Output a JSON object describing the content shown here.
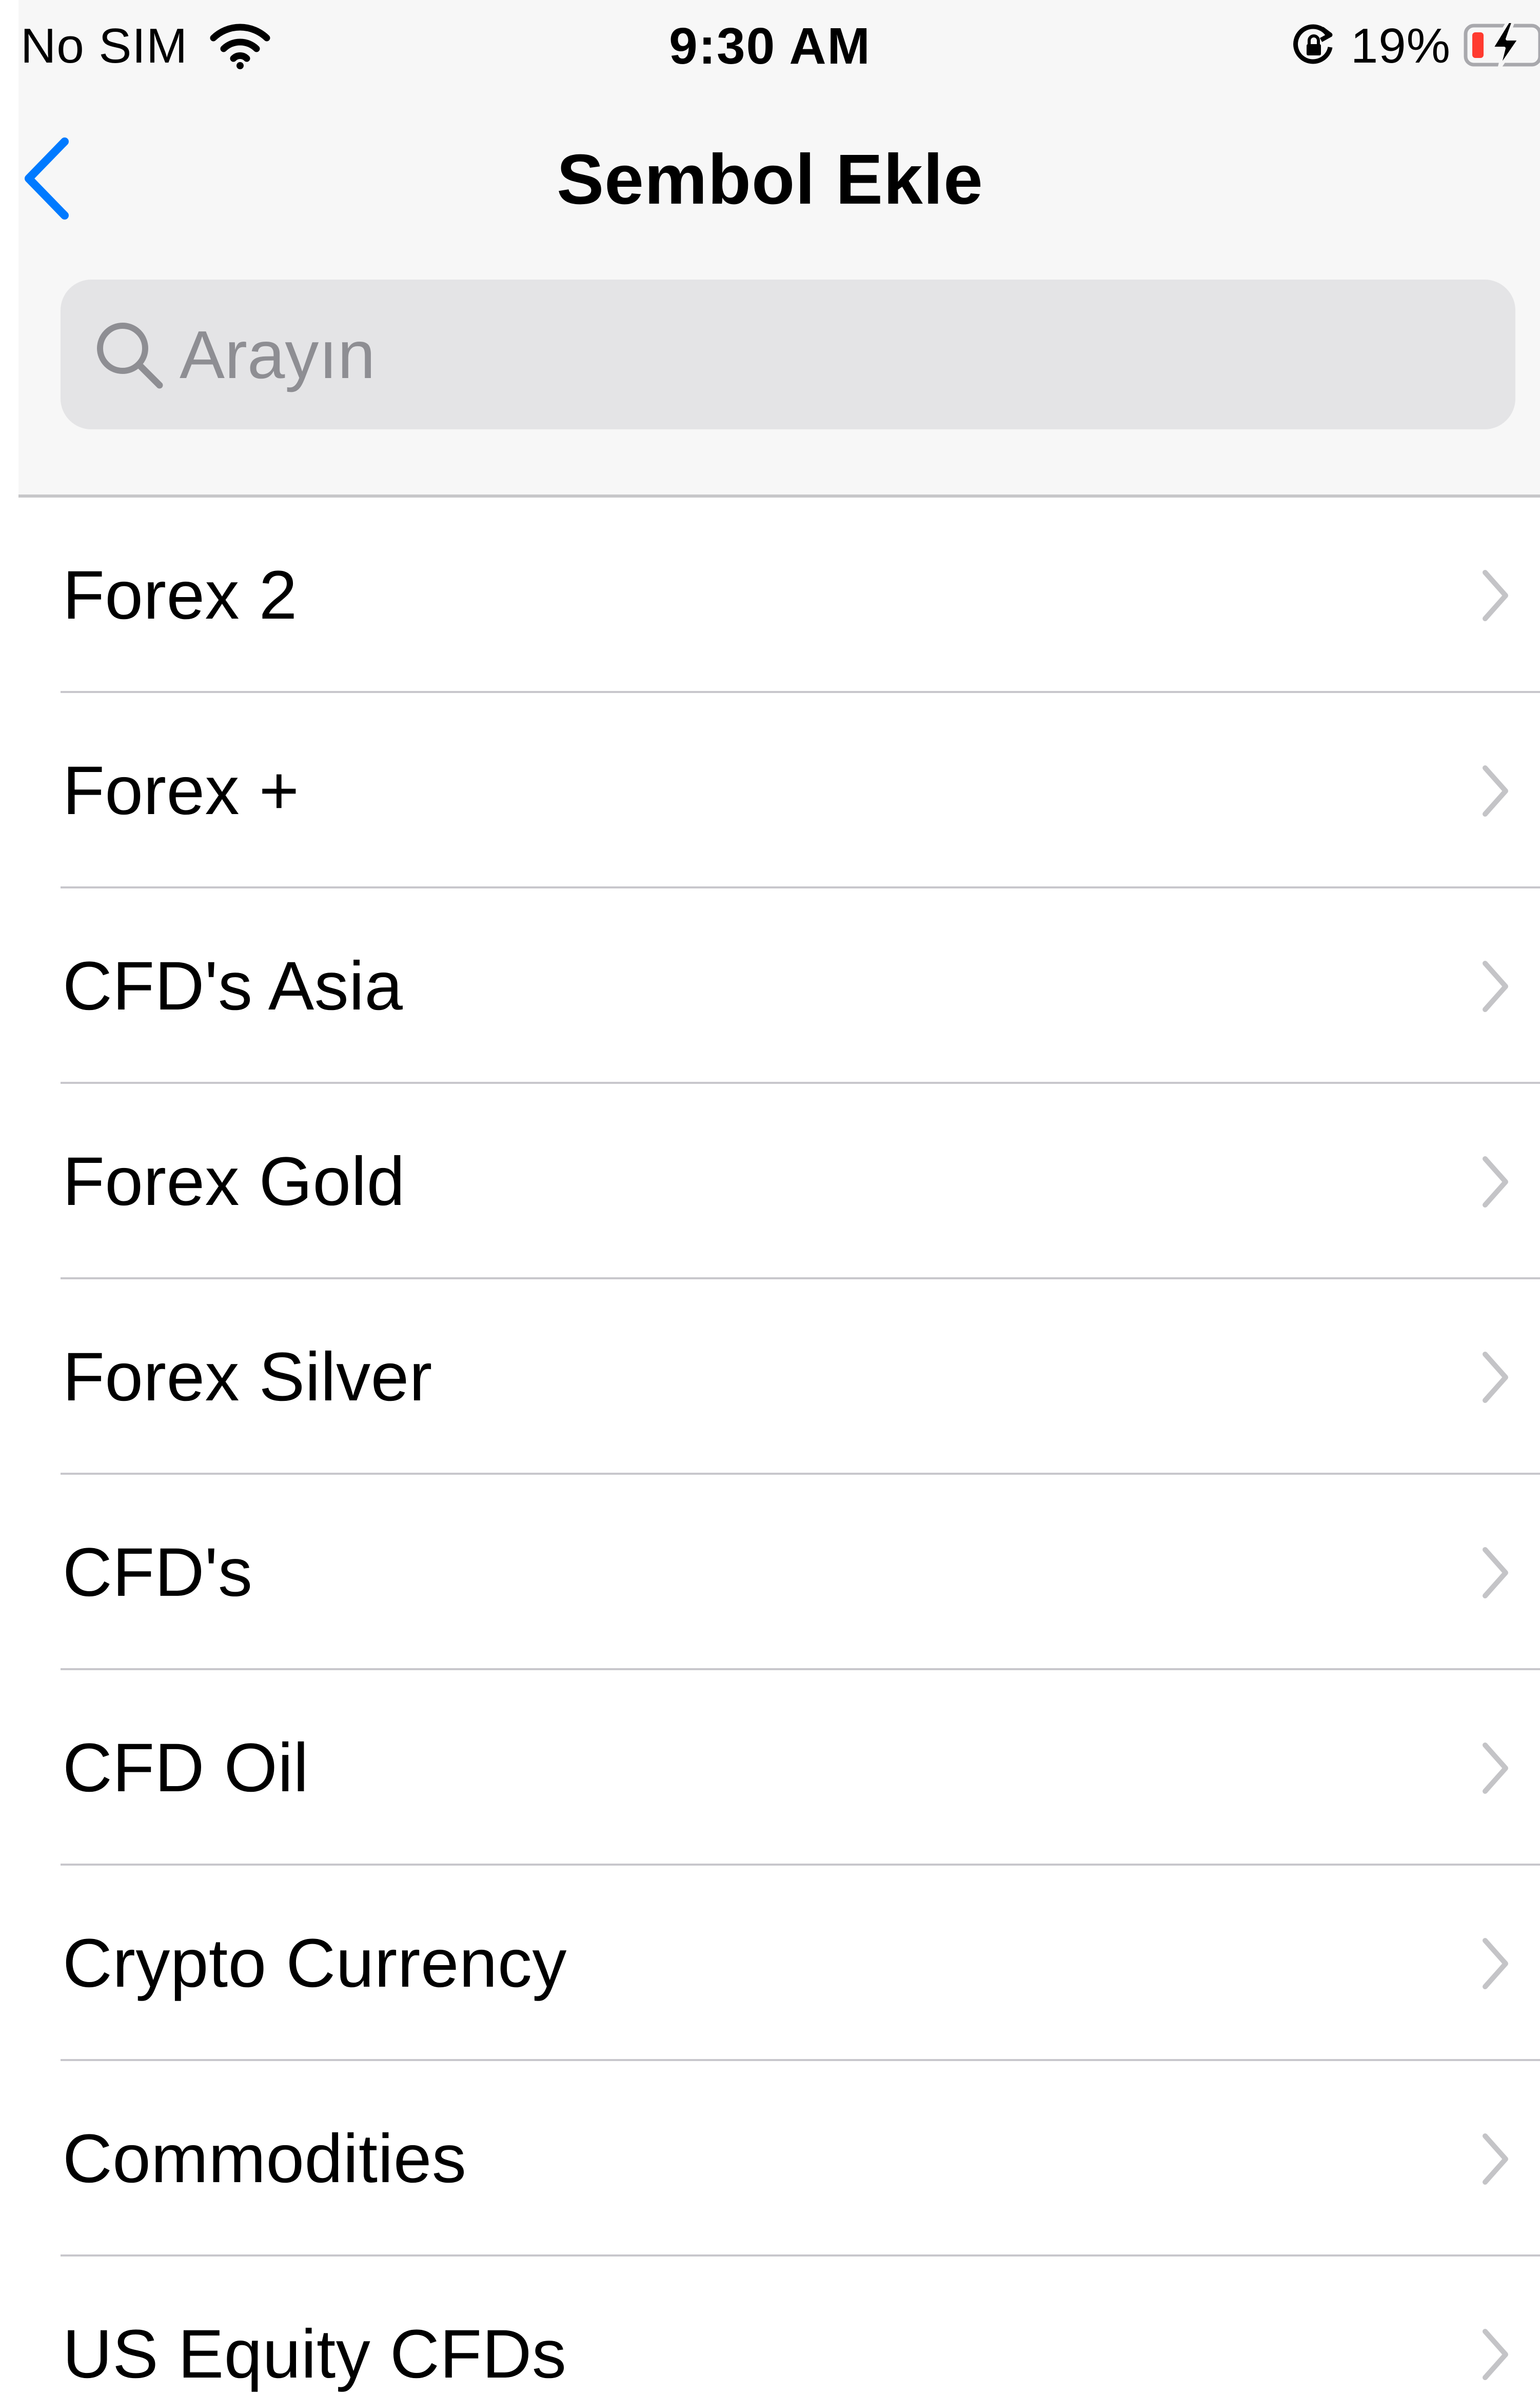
{
  "status_bar": {
    "carrier": "No SIM",
    "time": "9:30 AM",
    "battery_percent": "19%",
    "icons": [
      "wifi-icon",
      "orientation-lock-icon",
      "battery-charging-icon"
    ]
  },
  "nav": {
    "title": "Sembol Ekle",
    "back_icon": "chevron-left-icon"
  },
  "search": {
    "placeholder": "Arayın",
    "value": "",
    "icon": "search-icon"
  },
  "list": {
    "items": [
      {
        "label": "Forex 2"
      },
      {
        "label": "Forex +"
      },
      {
        "label": "CFD's Asia"
      },
      {
        "label": "Forex Gold"
      },
      {
        "label": "Forex Silver"
      },
      {
        "label": "CFD's"
      },
      {
        "label": "CFD Oil"
      },
      {
        "label": "Crypto Currency"
      },
      {
        "label": "Commodities"
      },
      {
        "label": "US Equity CFDs"
      }
    ],
    "disclosure_icon": "chevron-right-icon"
  },
  "colors": {
    "accent": "#007aff",
    "header_background": "#f7f7f7",
    "search_background": "#e4e4e6",
    "placeholder": "#8e8e93",
    "separator": "#c8c7cc",
    "chevron": "#c4c4c7",
    "battery_low": "#ff3b30"
  }
}
